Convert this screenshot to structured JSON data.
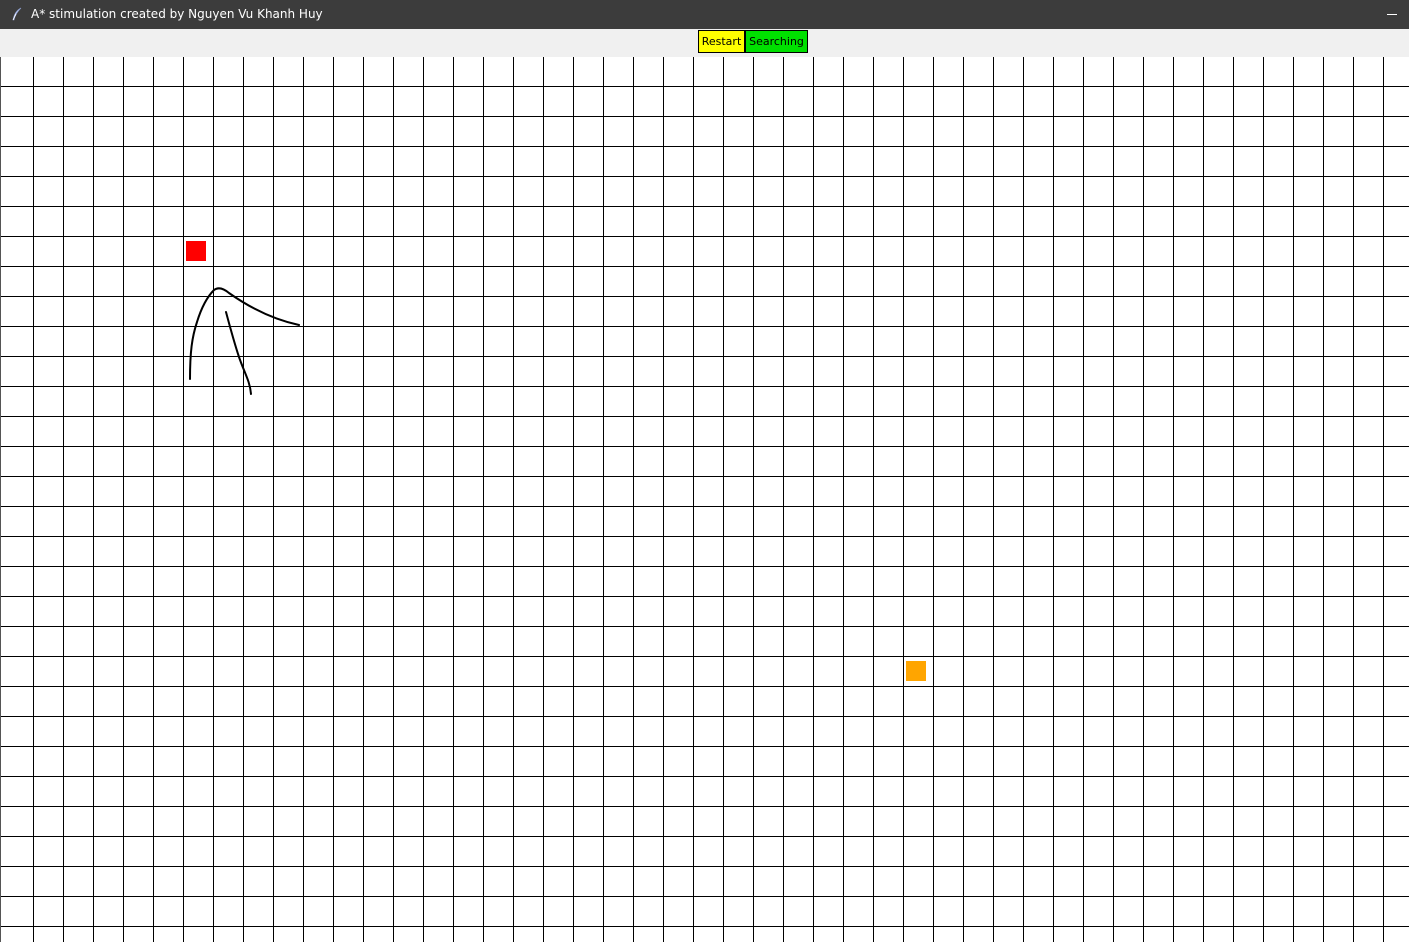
{
  "window": {
    "title": "A* stimulation created by Nguyen Vu Khanh Huy",
    "icon": "feather-icon",
    "controls": [
      "minimize-icon"
    ]
  },
  "toolbar": {
    "restart_label": "Restart",
    "restart_color": "#ffff00",
    "searching_label": "Searching",
    "searching_color": "#00e000"
  },
  "grid": {
    "line_color": "#000000",
    "background": "#ffffff",
    "start_node": {
      "row": 6,
      "col": 6,
      "color": "#ff0000"
    },
    "end_node": {
      "row": 20,
      "col": 30,
      "color": "#ffa500"
    },
    "barrier_stroke_color": "#000000"
  }
}
